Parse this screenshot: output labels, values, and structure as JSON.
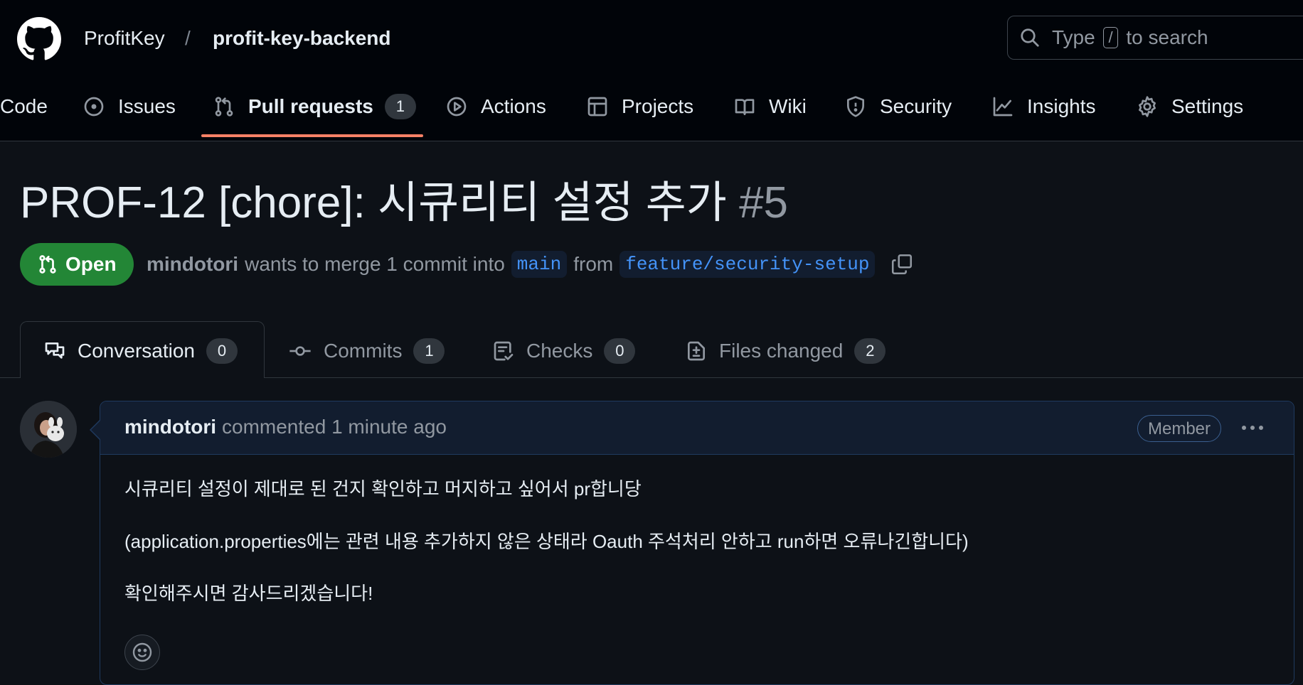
{
  "colors": {
    "header_bg": "#010409",
    "page_bg": "#0d1117",
    "open_badge": "#238636",
    "tab_underline": "#f78166",
    "link": "#4493f8",
    "muted": "#9198a1"
  },
  "breadcrumb": {
    "owner": "ProfitKey",
    "separator": "/",
    "repo": "profit-key-backend"
  },
  "search": {
    "prefix": "Type",
    "key": "/",
    "suffix": "to search",
    "icon": "search-icon"
  },
  "repo_nav": {
    "items": [
      {
        "label": "Code",
        "icon": "code-icon"
      },
      {
        "label": "Issues",
        "icon": "issue-icon"
      },
      {
        "label": "Pull requests",
        "icon": "git-pull-request-icon",
        "count": "1",
        "active": true
      },
      {
        "label": "Actions",
        "icon": "play-icon"
      },
      {
        "label": "Projects",
        "icon": "table-icon"
      },
      {
        "label": "Wiki",
        "icon": "book-icon"
      },
      {
        "label": "Security",
        "icon": "shield-icon"
      },
      {
        "label": "Insights",
        "icon": "graph-icon"
      },
      {
        "label": "Settings",
        "icon": "gear-icon"
      }
    ]
  },
  "pr": {
    "title": "PROF-12 [chore]: 시큐리티 설정 추가",
    "number": "#5",
    "state": "Open",
    "author": "mindotori",
    "merge_text": "wants to merge 1 commit into",
    "base_branch": "main",
    "from_text": "from",
    "head_branch": "feature/security-setup"
  },
  "tabs": [
    {
      "label": "Conversation",
      "count": "0",
      "icon": "comment-discussion-icon",
      "active": true
    },
    {
      "label": "Commits",
      "count": "1",
      "icon": "git-commit-icon"
    },
    {
      "label": "Checks",
      "count": "0",
      "icon": "checklist-icon"
    },
    {
      "label": "Files changed",
      "count": "2",
      "icon": "file-diff-icon"
    }
  ],
  "comment": {
    "author": "mindotori",
    "action": "commented 1 minute ago",
    "role_badge": "Member",
    "body": [
      "시큐리티 설정이 제대로 된 건지 확인하고 머지하고 싶어서 pr합니당",
      "(application.properties에는 관련 내용 추가하지 않은 상태라 Oauth 주석처리 안하고 run하면 오류나긴합니다)",
      "확인해주시면 감사드리겠습니다!"
    ]
  }
}
